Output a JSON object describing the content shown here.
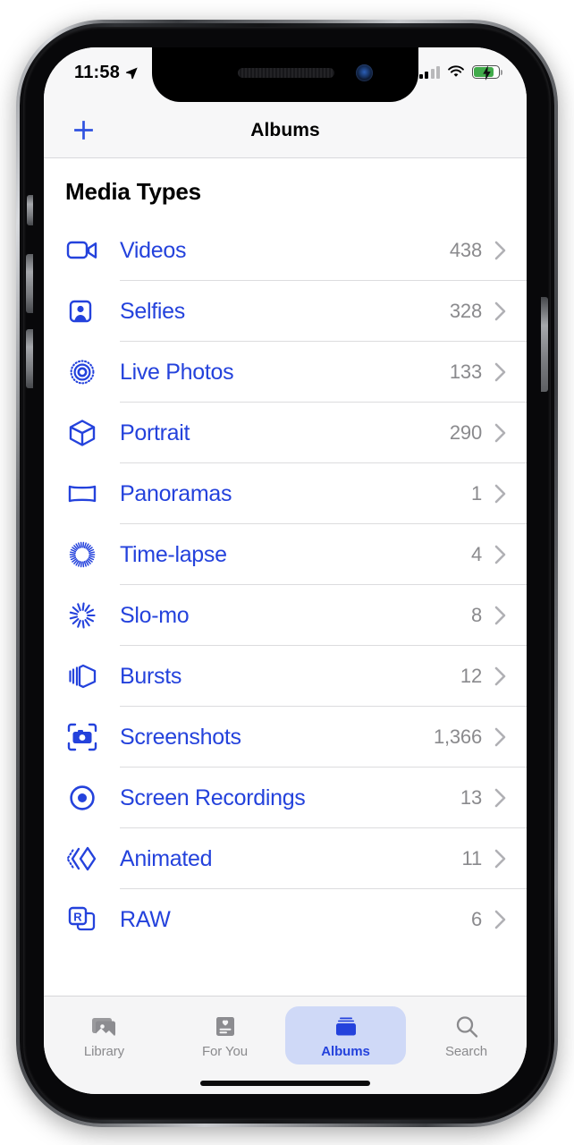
{
  "status_bar": {
    "time": "11:58",
    "location_icon": "location-arrow-icon",
    "signal_icon": "cellular-signal-icon",
    "wifi_icon": "wifi-icon",
    "battery_icon": "battery-charging-icon",
    "battery_bolt": "⚡"
  },
  "nav": {
    "add_icon": "plus-icon",
    "title": "Albums"
  },
  "main": {
    "section_title": "Media Types",
    "rows": [
      {
        "label": "Videos",
        "count": "438",
        "icon": "video-camera-icon",
        "chevron": "›"
      },
      {
        "label": "Selfies",
        "count": "328",
        "icon": "selfie-person-icon",
        "chevron": "›"
      },
      {
        "label": "Live Photos",
        "count": "133",
        "icon": "live-photo-icon",
        "chevron": "›"
      },
      {
        "label": "Portrait",
        "count": "290",
        "icon": "cube-portrait-icon",
        "chevron": "›"
      },
      {
        "label": "Panoramas",
        "count": "1",
        "icon": "panorama-icon",
        "chevron": "›"
      },
      {
        "label": "Time-lapse",
        "count": "4",
        "icon": "timelapse-icon",
        "chevron": "›"
      },
      {
        "label": "Slo-mo",
        "count": "8",
        "icon": "slomo-icon",
        "chevron": "›"
      },
      {
        "label": "Bursts",
        "count": "12",
        "icon": "burst-stack-icon",
        "chevron": "›"
      },
      {
        "label": "Screenshots",
        "count": "1,366",
        "icon": "screenshot-camera-icon",
        "chevron": "›"
      },
      {
        "label": "Screen Recordings",
        "count": "13",
        "icon": "record-circle-icon",
        "chevron": "›"
      },
      {
        "label": "Animated",
        "count": "11",
        "icon": "animated-chevrons-icon",
        "chevron": "›"
      },
      {
        "label": "RAW",
        "count": "6",
        "icon": "raw-badge-icon",
        "chevron": "›"
      }
    ]
  },
  "tabbar": {
    "tabs": [
      {
        "label": "Library",
        "icon": "photo-library-icon",
        "active": false
      },
      {
        "label": "For You",
        "icon": "for-you-card-icon",
        "active": false
      },
      {
        "label": "Albums",
        "icon": "albums-folder-icon",
        "active": true
      },
      {
        "label": "Search",
        "icon": "search-icon",
        "active": false
      }
    ]
  },
  "colors": {
    "accent_blue": "#2442dc",
    "count_gray": "#8a8a8d",
    "tab_inactive": "#8a8a8d",
    "tab_active_pill": "#cfd9f7",
    "battery_green": "#41ab4b",
    "separator": "#dcdcde"
  }
}
